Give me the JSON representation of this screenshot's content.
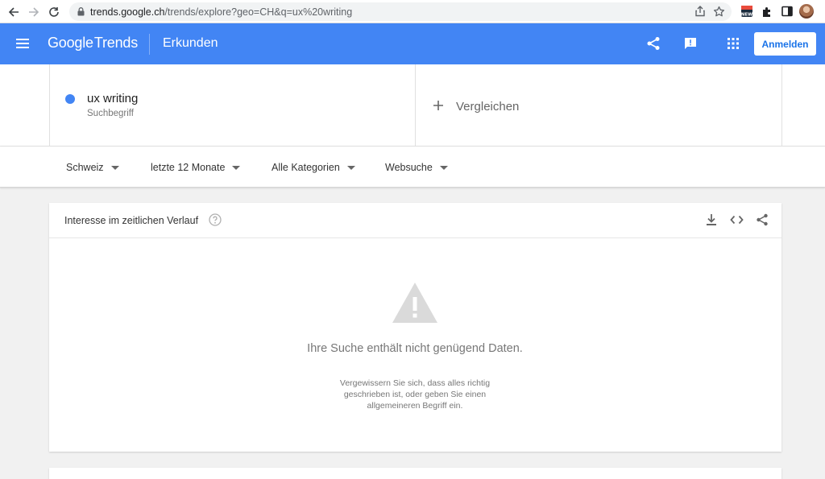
{
  "browser": {
    "url_host": "trends.google.ch",
    "url_rest": "/trends/explore?geo=CH&q=ux%20writing",
    "extension_new_label": "NEW"
  },
  "header": {
    "logo_google": "Google",
    "logo_trends": "Trends",
    "title": "Erkunden",
    "signin_label": "Anmelden",
    "bar_color": "#4285f4"
  },
  "term": {
    "name": "ux writing",
    "type": "Suchbegriff",
    "color": "#4285f4"
  },
  "compare": {
    "label": "Vergleichen"
  },
  "filters": {
    "region": "Schweiz",
    "time": "letzte 12 Monate",
    "category": "Alle Kategorien",
    "search_type": "Websuche"
  },
  "card": {
    "title": "Interesse im zeitlichen Verlauf",
    "empty_title": "Ihre Suche enthält nicht genügend Daten.",
    "empty_description": "Vergewissern Sie sich, dass alles richtig geschrieben ist, oder geben Sie einen allgemeineren Begriff ein."
  }
}
